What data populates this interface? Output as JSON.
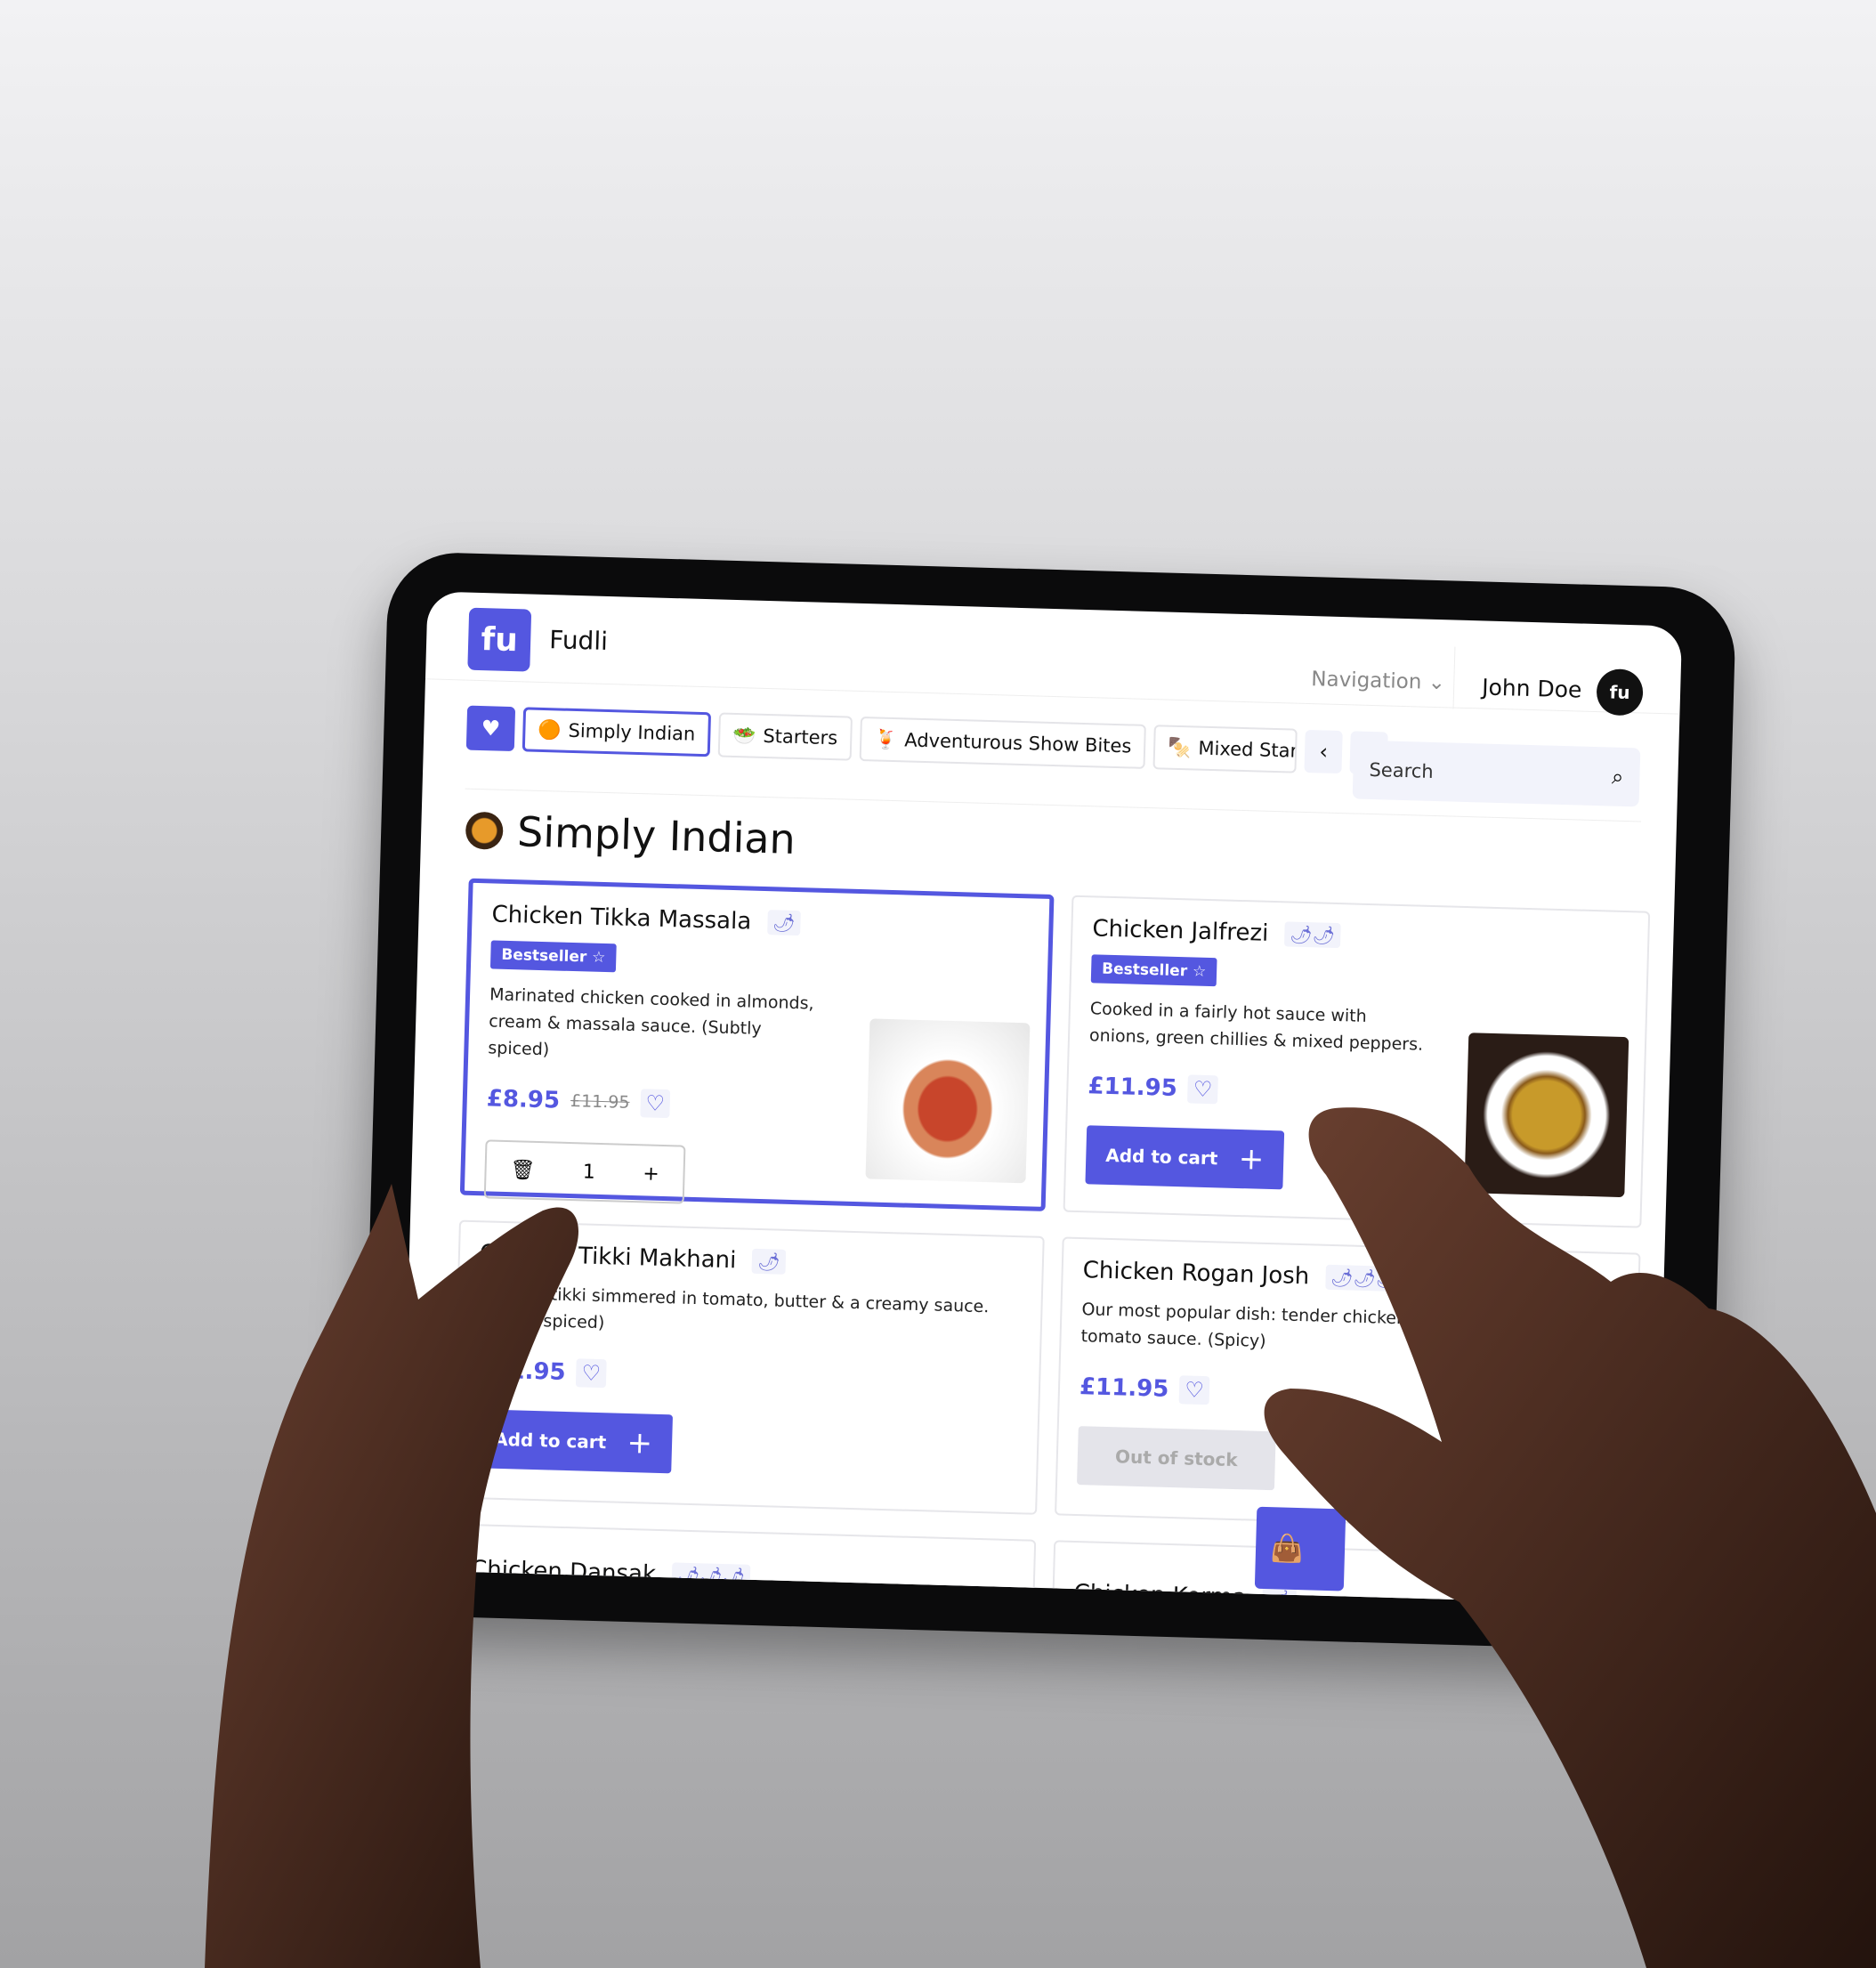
{
  "app": {
    "logo_text": "fu",
    "name": "Fudli"
  },
  "header": {
    "navigation_label": "Navigation",
    "user_name": "John Doe",
    "avatar_text": "fu"
  },
  "tabs": [
    {
      "label": "Simply Indian",
      "active": true
    },
    {
      "label": "Starters"
    },
    {
      "label": "Adventurous Show Bites"
    },
    {
      "label": "Mixed Starters"
    }
  ],
  "search": {
    "placeholder": "Search"
  },
  "section": {
    "title": "Simply Indian"
  },
  "items": [
    {
      "name": "Chicken Tikka Massala",
      "spice": "🌶",
      "badge": "Bestseller ☆",
      "description": "Marinated chicken cooked in almonds, cream & massala sauce. (Subtly spiced)",
      "price": "£8.95",
      "old_price": "£11.95",
      "quantity": "1",
      "selected": true
    },
    {
      "name": "Chicken Jalfrezi",
      "spice": "🌶🌶",
      "badge": "Bestseller ☆",
      "description": "Cooked in a fairly hot sauce with onions, green chillies & mixed peppers.",
      "price": "£11.95",
      "action": "Add to cart"
    },
    {
      "name": "Chicken Tikki Makhani",
      "spice": "🌶",
      "description": "Chicken tikki simmered in tomato, butter & a creamy sauce. (Subtly spiced)",
      "price": "£11.95",
      "action": "Add to cart"
    },
    {
      "name": "Chicken Rogan Josh",
      "spice": "🌶🌶🌶",
      "description": "Our most popular dish: tender chicken cooked in a rich onion & tomato sauce. (Spicy)",
      "price": "£11.95",
      "action": "Out of stock"
    },
    {
      "name": "Chicken Dansak",
      "spice": "🌶🌶🌶"
    },
    {
      "name": "Chicken Korma",
      "spice": "🌶"
    }
  ],
  "colors": {
    "accent": "#5457e0",
    "tab_bg": "#f2f3fb",
    "disabled": "#e4e4ea"
  }
}
